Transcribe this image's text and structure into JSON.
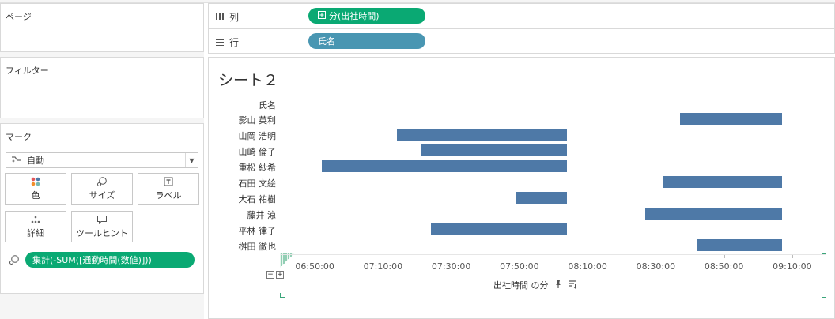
{
  "panels": {
    "pages": "ページ",
    "filters": "フィルター",
    "marks": "マーク"
  },
  "marks_card": {
    "type_selected": "自動",
    "buttons": {
      "color": "色",
      "size": "サイズ",
      "label": "ラベル",
      "detail": "詳細",
      "tooltip": "ツールヒント"
    },
    "field_pill": "集計(-SUM([通勤時間(数値)]))"
  },
  "shelves": {
    "columns_label": "列",
    "columns_pill": "分(出社時間)",
    "rows_label": "行",
    "rows_pill": "氏名"
  },
  "sheet": {
    "title": "シート２"
  },
  "colors": {
    "bar": "#4e79a7",
    "pill_green": "#0aa973",
    "pill_blue": "#4996b2"
  },
  "chart_data": {
    "type": "bar",
    "orientation": "horizontal-range",
    "row_header": "氏名",
    "xlabel": "出社時間 の分",
    "ylabel": "",
    "x_ticks": [
      "06:50:00",
      "07:10:00",
      "07:30:00",
      "07:50:00",
      "08:10:00",
      "08:30:00",
      "08:50:00",
      "09:10:00"
    ],
    "xlim": [
      "06:40:00",
      "09:20:00"
    ],
    "categories": [
      "影山 英利",
      "山岡 浩明",
      "山崎 倫子",
      "重松 紗希",
      "石田 文絵",
      "大石 祐樹",
      "藤井 涼",
      "平林 律子",
      "桝田 徹也"
    ],
    "series": [
      {
        "start": [
          "08:37:00",
          "07:14:00",
          "07:21:00",
          "06:52:00",
          "08:32:00",
          "07:49:00",
          "08:27:00",
          "07:24:00",
          "08:42:00"
        ],
        "end": [
          "09:07:00",
          "08:04:00",
          "08:04:00",
          "08:04:00",
          "09:07:00",
          "08:04:00",
          "09:07:00",
          "08:04:00",
          "09:07:00"
        ]
      }
    ]
  }
}
